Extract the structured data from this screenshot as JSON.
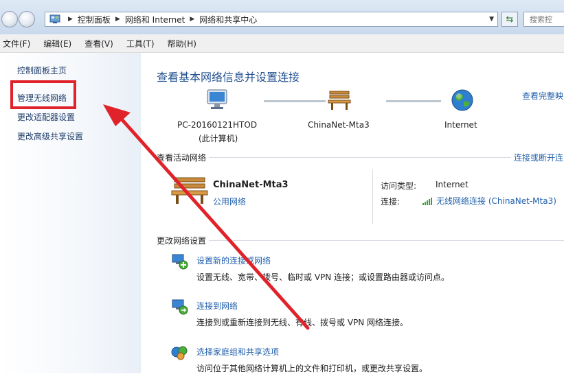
{
  "window": {
    "breadcrumb": [
      "控制面板",
      "网络和 Internet",
      "网络和共享中心"
    ],
    "search_placeholder": "搜索控"
  },
  "menu": [
    "文件(F)",
    "编辑(E)",
    "查看(V)",
    "工具(T)",
    "帮助(H)"
  ],
  "sidebar": {
    "items": [
      {
        "label": "控制面板主页"
      },
      {
        "label": "管理无线网络",
        "highlighted": true
      },
      {
        "label": "更改适配器设置"
      },
      {
        "label": "更改高级共享设置"
      }
    ]
  },
  "main": {
    "title": "查看基本网络信息并设置连接",
    "see_full_map": "查看完整映",
    "network_map": {
      "computer": {
        "name": "PC-20160121HTOD",
        "sub": "(此计算机)"
      },
      "network": {
        "name": "ChinaNet-Mta3"
      },
      "internet": {
        "name": "Internet"
      }
    },
    "active_networks": {
      "heading": "查看活动网络",
      "connect_link": "连接或断开连",
      "network_name": "ChinaNet-Mta3",
      "network_type": "公用网络",
      "access_type_key": "访问类型:",
      "access_type_value": "Internet",
      "connection_key": "连接:",
      "connection_value": "无线网络连接 (ChinaNet-Mta3)"
    },
    "change_settings": {
      "heading": "更改网络设置",
      "tasks": [
        {
          "title": "设置新的连接或网络",
          "desc": "设置无线、宽带、拨号、临时或 VPN 连接；或设置路由器或访问点。"
        },
        {
          "title": "连接到网络",
          "desc": "连接到或重新连接到无线、有线、拨号或 VPN 网络连接。"
        },
        {
          "title": "选择家庭组和共享选项",
          "desc": "访问位于其他网络计算机上的文件和打印机，或更改共享设置。"
        }
      ]
    }
  },
  "colors": {
    "link": "#1f5eab",
    "title": "#1f4f8f",
    "annotation_red": "#e0232a"
  }
}
